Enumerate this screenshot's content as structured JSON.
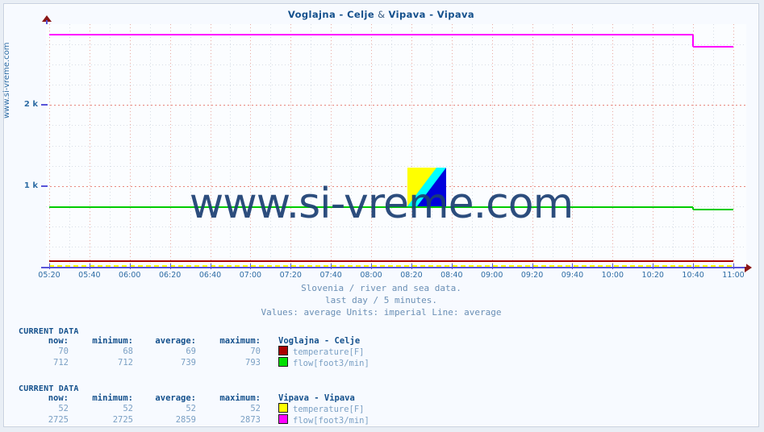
{
  "chart_data": {
    "type": "line",
    "title": "Voglajna - Celje & Vipava - Vipava",
    "subtitle_1": "Slovenia / river and sea data.",
    "subtitle_2": "last day / 5 minutes.",
    "subtitle_3": "Values: average  Units: imperial  Line: average",
    "xlabel": "",
    "ylabel": "",
    "ylim": [
      0,
      3000
    ],
    "ytick_labels": [
      "1 k",
      "2 k"
    ],
    "ytick_values": [
      1000,
      2000
    ],
    "grid": true,
    "legend_position": "below-chart-table",
    "x": [
      "05:20",
      "05:40",
      "06:00",
      "06:20",
      "06:40",
      "07:00",
      "07:20",
      "07:40",
      "08:00",
      "08:20",
      "08:40",
      "09:00",
      "09:20",
      "09:40",
      "10:00",
      "10:20",
      "10:40",
      "11:00"
    ],
    "series": [
      {
        "name": "Voglajna - Celje temperature[F]",
        "color": "#aa0000",
        "unit": "F",
        "values": [
          70,
          70,
          70,
          70,
          70,
          70,
          70,
          70,
          70,
          70,
          70,
          70,
          70,
          70,
          70,
          70,
          70,
          70
        ]
      },
      {
        "name": "Voglajna - Celje flow[foot3/min]",
        "color": "#00cc00",
        "unit": "foot3/min",
        "values": [
          739,
          739,
          739,
          739,
          739,
          739,
          739,
          739,
          739,
          739,
          739,
          739,
          739,
          739,
          739,
          739,
          712,
          712
        ]
      },
      {
        "name": "Vipava - Vipava temperature[F]",
        "color": "#ffff00",
        "unit": "F",
        "values": [
          52,
          52,
          52,
          52,
          52,
          52,
          52,
          52,
          52,
          52,
          52,
          52,
          52,
          52,
          52,
          52,
          52,
          52
        ]
      },
      {
        "name": "Vipava - Vipava flow[foot3/min]",
        "color": "#ff00ff",
        "unit": "foot3/min",
        "values": [
          2873,
          2873,
          2873,
          2873,
          2873,
          2873,
          2873,
          2873,
          2873,
          2873,
          2873,
          2873,
          2873,
          2873,
          2873,
          2873,
          2725,
          2725
        ]
      }
    ]
  },
  "branding": {
    "vertical_watermark": "www.si-vreme.com",
    "center_watermark": "www.si-vreme.com",
    "logo_name": "si-vreme-logo",
    "logo_colors": {
      "top": "#ffff00",
      "band": "#00ffff",
      "bottom": "#0000dd"
    }
  },
  "colors": {
    "title": "#14508c",
    "axis": "#5753d8",
    "arrow": "#8a1616",
    "value_text": "#7ba0c4",
    "header_text": "#14508c",
    "background": "#f7faff",
    "page_background": "#e9eef5"
  },
  "tables": [
    {
      "caption": "CURRENT DATA",
      "station": "Voglajna - Celje",
      "headers": [
        "now:",
        "minimum:",
        "average:",
        "maximum:"
      ],
      "rows": [
        {
          "now": "70",
          "minimum": "68",
          "average": "69",
          "maximum": "70",
          "label": "temperature[F]",
          "color": "#aa0000"
        },
        {
          "now": "712",
          "minimum": "712",
          "average": "739",
          "maximum": "793",
          "label": "flow[foot3/min]",
          "color": "#00e000"
        }
      ]
    },
    {
      "caption": "CURRENT DATA",
      "station": "Vipava - Vipava",
      "headers": [
        "now:",
        "minimum:",
        "average:",
        "maximum:"
      ],
      "rows": [
        {
          "now": "52",
          "minimum": "52",
          "average": "52",
          "maximum": "52",
          "label": "temperature[F]",
          "color": "#ffff00"
        },
        {
          "now": "2725",
          "minimum": "2725",
          "average": "2859",
          "maximum": "2873",
          "label": "flow[foot3/min]",
          "color": "#ff00ff"
        }
      ]
    }
  ]
}
